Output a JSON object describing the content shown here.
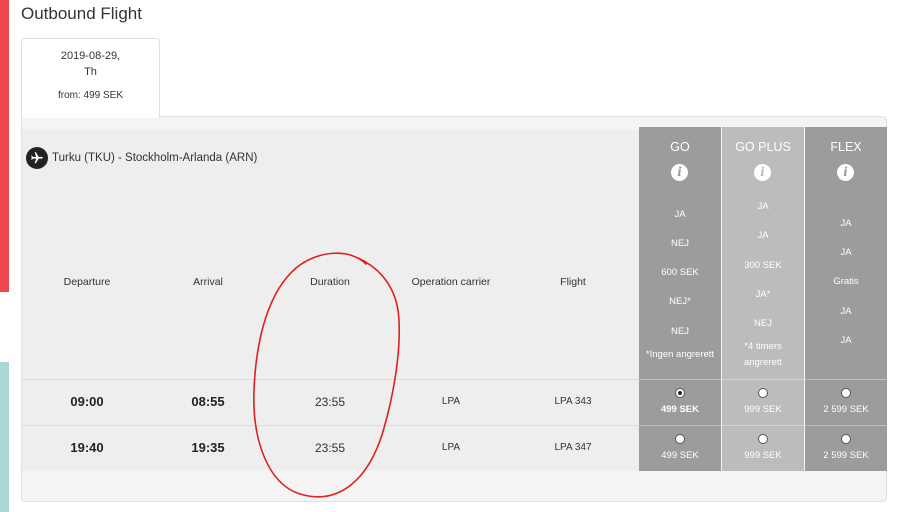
{
  "page": {
    "title": "Outbound Flight"
  },
  "date_tab": {
    "date": "2019-08-29,",
    "weekday": "Th",
    "from_price": "from: 499 SEK"
  },
  "route": {
    "label": "Turku (TKU) - Stockholm-Arlanda (ARN)",
    "icon": "airplane-icon"
  },
  "columns": {
    "departure": "Departure",
    "arrival": "Arrival",
    "duration": "Duration",
    "carrier": "Operation carrier",
    "flight": "Flight"
  },
  "flights": [
    {
      "departure": "09:00",
      "arrival": "08:55",
      "duration": "23:55",
      "carrier": "LPA",
      "flight": "LPA 343"
    },
    {
      "departure": "19:40",
      "arrival": "19:35",
      "duration": "23:55",
      "carrier": "LPA",
      "flight": "LPA 347"
    }
  ],
  "fares": [
    {
      "name": "GO",
      "color": "#9c9c9c",
      "features": [
        "JA",
        "NEJ",
        "600 SEK",
        "NEJ*",
        "NEJ",
        "*Ingen angrerett"
      ],
      "prices": [
        "499 SEK",
        "499 SEK"
      ],
      "selected_row": 0
    },
    {
      "name": "GO PLUS",
      "color": "#bcbcbc",
      "features": [
        "JA",
        "JA",
        "300 SEK",
        "JA*",
        "NEJ",
        "*4 timers",
        "angrerett"
      ],
      "prices": [
        "999 SEK",
        "999 SEK"
      ],
      "selected_row": -1
    },
    {
      "name": "FLEX",
      "color": "#9c9c9c",
      "features": [
        "JA",
        "JA",
        "Gratis",
        "JA",
        "JA"
      ],
      "prices": [
        "2 599 SEK",
        "2 599 SEK"
      ],
      "selected_row": -1
    }
  ],
  "colors": {
    "accent_red": "#f0474f",
    "accent_teal": "#a9d8d6",
    "annotation": "#e02020"
  }
}
